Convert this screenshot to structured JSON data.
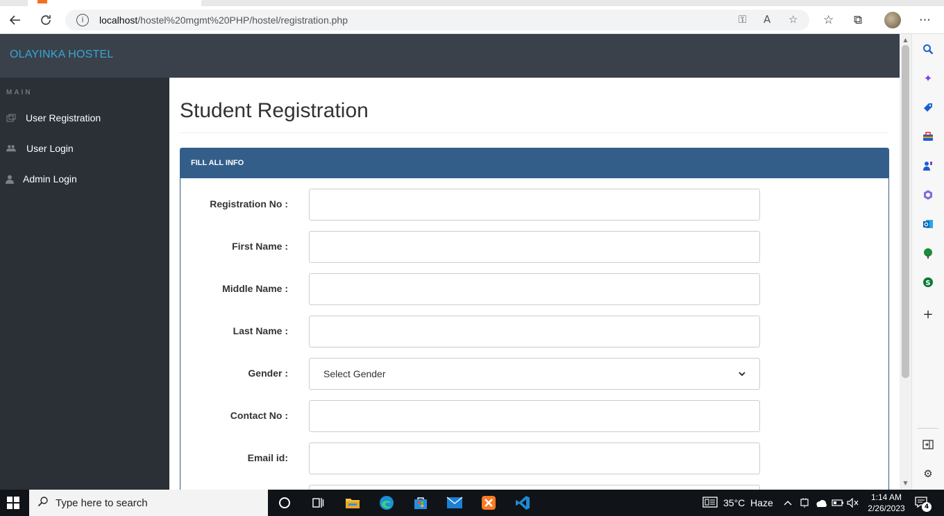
{
  "browser": {
    "url_host": "localhost",
    "url_path": "/hostel%20mgmt%20PHP/hostel/registration.php",
    "icons": {
      "back": "back-arrow-icon",
      "refresh": "refresh-icon",
      "info": "info-icon",
      "key": "key-icon",
      "read_aloud": "read-aloud-icon",
      "add_favorite": "add-favorite-icon",
      "favorites": "favorites-icon",
      "collections": "collections-icon",
      "profile": "profile-avatar",
      "more": "more-icon"
    }
  },
  "app": {
    "brand": "OLAYINKA HOSTEL",
    "sidebar": {
      "section": "MAIN",
      "items": [
        {
          "label": "User Registration",
          "icon": "registration-icon"
        },
        {
          "label": "User Login",
          "icon": "users-icon"
        },
        {
          "label": "Admin Login",
          "icon": "user-icon"
        }
      ]
    },
    "page_title": "Student Registration",
    "panel_title": "FILL ALL INFO",
    "form": {
      "fields": [
        {
          "label": "Registration No :",
          "value": ""
        },
        {
          "label": "First Name :",
          "value": ""
        },
        {
          "label": "Middle Name :",
          "value": ""
        },
        {
          "label": "Last Name :",
          "value": ""
        },
        {
          "label": "Gender :",
          "value": "Select Gender",
          "type": "select"
        },
        {
          "label": "Contact No :",
          "value": ""
        },
        {
          "label": "Email id:",
          "value": ""
        }
      ]
    }
  },
  "edge_sidebar": [
    "search-icon",
    "copilot-icon",
    "shopping-icon",
    "tools-icon",
    "games-icon",
    "microsoft365-icon",
    "outlook-icon",
    "tree-icon",
    "skype-icon",
    "add-icon",
    "split-screen-icon",
    "settings-icon"
  ],
  "taskbar": {
    "search_placeholder": "Type here to search",
    "weather": "35°C  Haze",
    "time": "1:14 AM",
    "date": "2/26/2023",
    "notifications": "4"
  }
}
